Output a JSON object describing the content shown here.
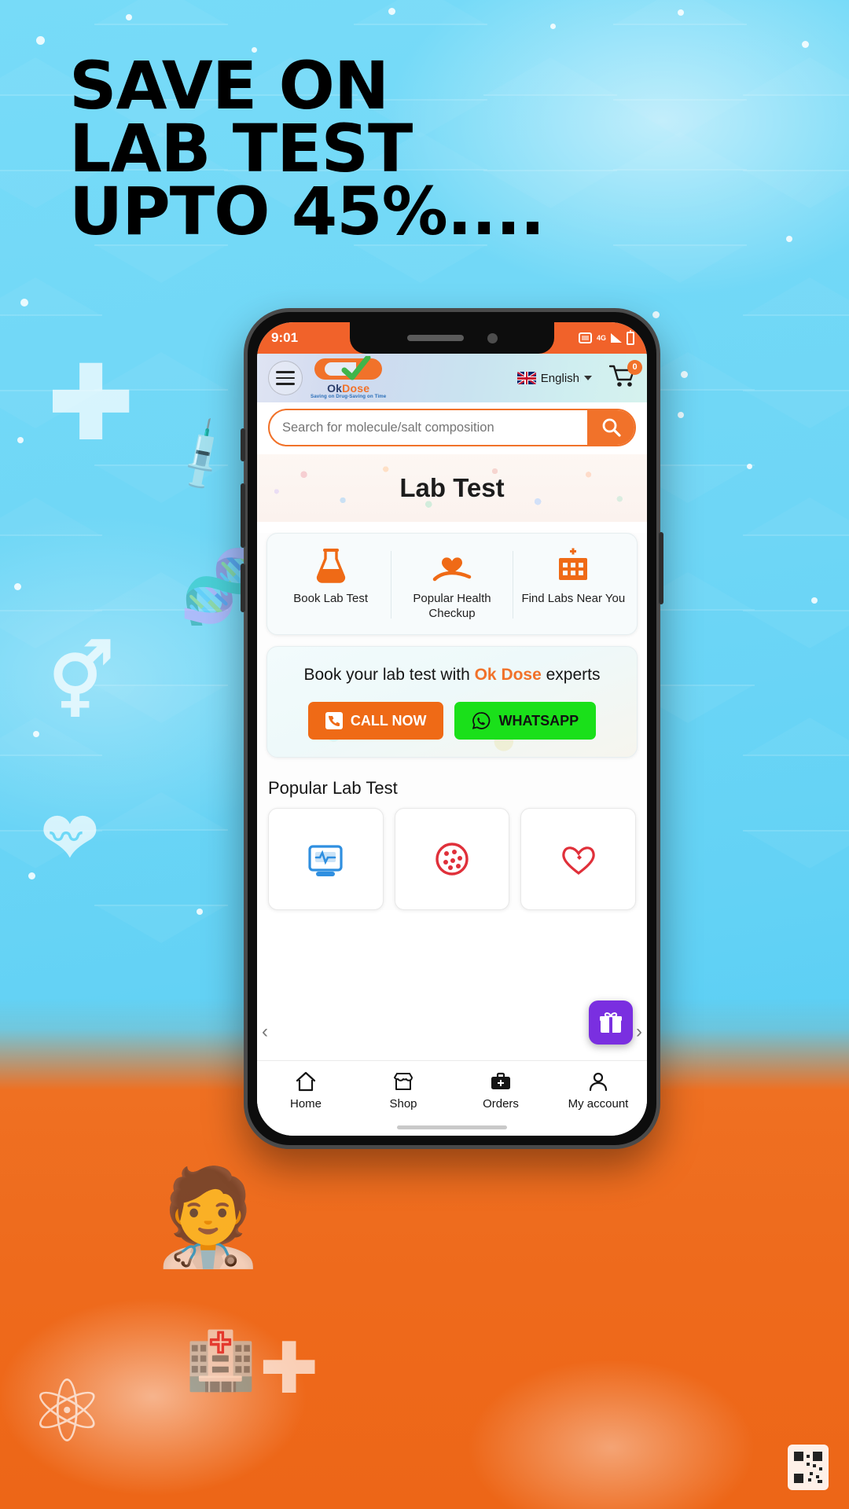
{
  "promo": {
    "headline_lines": [
      "SAVE ON",
      "LAB TEST",
      "UPTO 45%...."
    ],
    "bg_top_color": "#6fd9f7",
    "bg_bottom_color": "#ef7022"
  },
  "phone": {
    "statusbar": {
      "time": "9:01",
      "icons": [
        "sim-card-icon",
        "network-4g-icon",
        "signal-icon",
        "battery-icon"
      ],
      "network_label": "4G",
      "bg_color": "#f1622a"
    },
    "header": {
      "menu_label": "hamburger-menu",
      "logo": {
        "brand_first": "Ok",
        "brand_second": "Dose",
        "tagline": "Saving on Drug-Saving on Time"
      },
      "language": {
        "label": "English",
        "flag": "uk-flag-icon"
      },
      "cart": {
        "count": "0"
      }
    },
    "search": {
      "placeholder": "Search for molecule/salt composition",
      "value": "",
      "button_icon": "search-icon",
      "accent_color": "#f1722a"
    },
    "banner": {
      "title": "Lab Test"
    },
    "services": [
      {
        "icon": "flask-icon",
        "label": "Book Lab Test"
      },
      {
        "icon": "heart-in-hand-icon",
        "label": "Popular Health Checkup"
      },
      {
        "icon": "hospital-icon",
        "label": "Find Labs Near You"
      }
    ],
    "expert": {
      "text_before": "Book your lab test with ",
      "brand": "Ok Dose",
      "text_after": " experts",
      "buttons": [
        {
          "label": "CALL NOW",
          "icon": "phone-icon",
          "color": "#ef6a16"
        },
        {
          "label": "WHATSAPP",
          "icon": "whatsapp-icon",
          "color": "#1ae01a"
        }
      ]
    },
    "popular": {
      "title": "Popular Lab Test",
      "tiles": [
        {
          "icon": "blood-pressure-monitor-icon"
        },
        {
          "icon": "blood-cells-icon"
        },
        {
          "icon": "heart-health-icon"
        }
      ],
      "prev_arrow": "‹",
      "next_arrow": "›"
    },
    "gift_fab": {
      "icon": "gift-icon",
      "color": "#7a2fe0"
    },
    "bottom_nav": [
      {
        "icon": "home-icon",
        "label": "Home"
      },
      {
        "icon": "shop-icon",
        "label": "Shop"
      },
      {
        "icon": "orders-icon",
        "label": "Orders"
      },
      {
        "icon": "account-icon",
        "label": "My account"
      }
    ]
  }
}
